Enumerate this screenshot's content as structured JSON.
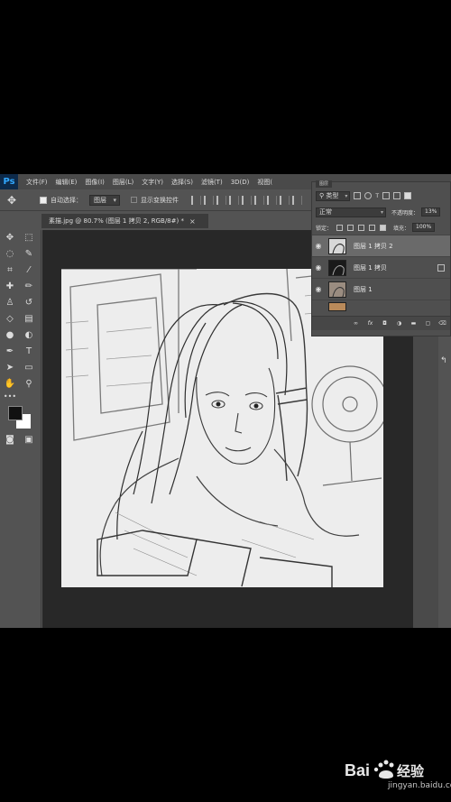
{
  "app": {
    "logo": "Ps"
  },
  "menu": [
    "文件(F)",
    "编辑(E)",
    "图像(I)",
    "图层(L)",
    "文字(Y)",
    "选择(S)",
    "滤镜(T)",
    "3D(D)",
    "视图("
  ],
  "options": {
    "auto_select_label": "自动选择：",
    "auto_select_value": "图层",
    "show_transform_label": "显示变换控件"
  },
  "document_tab": {
    "title": "素描.jpg @ 80.7% (图层 1 拷贝 2, RGB/8#) *",
    "close": "×"
  },
  "layers_panel": {
    "tab_label": "图层",
    "filter_label": "类型",
    "blend_mode": "正常",
    "opacity_label": "不透明度：",
    "opacity_value": "13%",
    "lock_label": "锁定：",
    "fill_label": "填充：",
    "fill_value": "100%",
    "layers": [
      {
        "name": "图层 1 拷贝 2",
        "selected": true
      },
      {
        "name": "图层 1 拷贝",
        "selected": false
      },
      {
        "name": "图层 1",
        "selected": false
      }
    ]
  },
  "colors": {
    "foreground": "#111111",
    "background": "#ffffff",
    "ps_blue": "#31a8ff"
  },
  "watermark": {
    "site": "jingyan.baidu.com",
    "brand": "Bai du 经验"
  }
}
